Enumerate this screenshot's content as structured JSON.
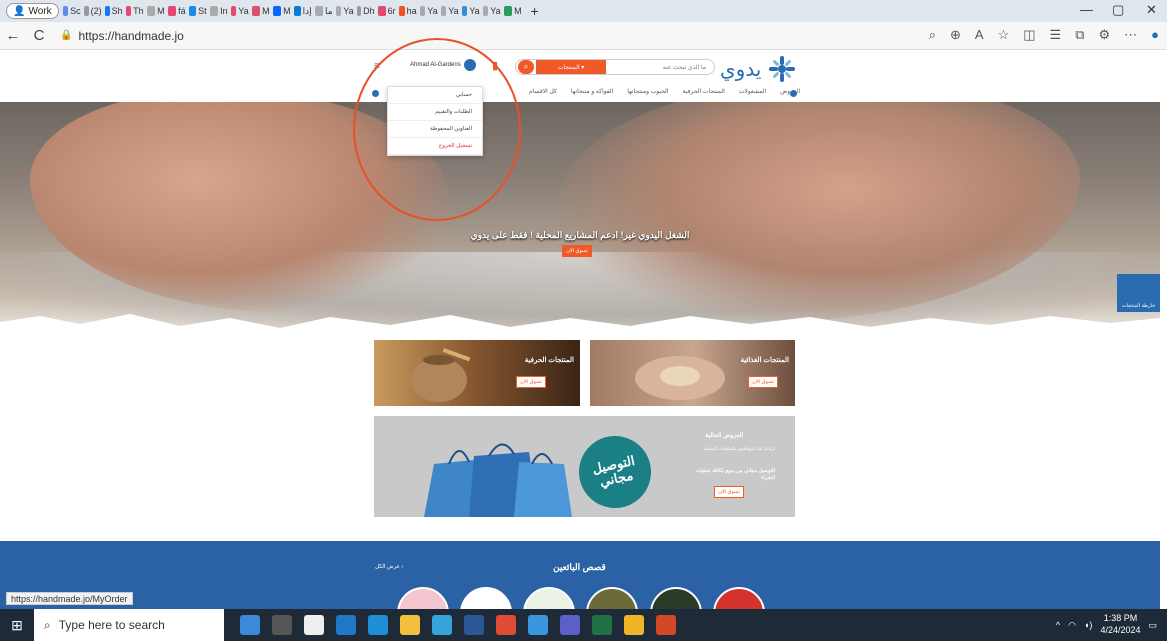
{
  "browser": {
    "profile_label": "Work",
    "tab_labels": [
      "Sc",
      "(2)",
      "Sh",
      "Th",
      "M",
      "fá",
      "St",
      "In",
      "Ya",
      "M",
      "M",
      "إدا",
      "ما",
      "Ya",
      "Dh",
      "6r",
      "ha",
      "Ya",
      "Ya",
      "Ya",
      "Ya",
      "M"
    ],
    "url": "https://handmade.jo",
    "new_tab": "+",
    "minimize": "—",
    "restore": "▢",
    "close": "✕",
    "back": "←",
    "reload": "C"
  },
  "site": {
    "logo_text": "يدوي",
    "user_name": "Ahmad Al-Gardens",
    "search_placeholder": "ما الذي تبحث عنه",
    "search_category": "المنتجات ▾",
    "nav_items": [
      "كل الاقسام",
      "الفواكه و منتجاتها",
      "الحبوب ومنتجاتها",
      "المنتجات الحرفية",
      "المشغولات",
      "العروض"
    ],
    "dropdown": [
      "حسابي",
      "الطلبات والتقييم",
      "العناوين المحفوظة",
      "تسجيل الخروج"
    ],
    "hero_title": "الشغل اليدوي غير! ادعم المشاريع المحلية ! فقط على يدوي",
    "hero_button": "تسوق الان",
    "side_tab": "خارطة المنتجات",
    "cards": [
      {
        "title": "المنتجات الحرفية",
        "button": "تسوق الان"
      },
      {
        "title": "المنتجات الغذائية",
        "button": "تسوق الان"
      }
    ],
    "promo": {
      "title": "العروض الحالية",
      "subtitle": "لزيادة ثقة المواطنين بالمنتجات المحلية",
      "highlight": "التوصيل مجاني من يدوي لكافة عمليات الشراء",
      "badge_line1": "التوصيل",
      "badge_line2": "مجاني",
      "button": "تسوق الان"
    },
    "stories": {
      "title": "قصص البائعين",
      "view_all": "عرض الكل ›"
    }
  },
  "status_url": "https://handmade.jo/MyOrder",
  "taskbar": {
    "search_placeholder": "Type here to search",
    "time": "1:38 PM",
    "date": "4/24/2024"
  },
  "colors": {
    "accent": "#f05a28",
    "brand_blue": "#2a6cb0",
    "stories_bg": "#2b62a5",
    "annotation": "#e8502a"
  }
}
